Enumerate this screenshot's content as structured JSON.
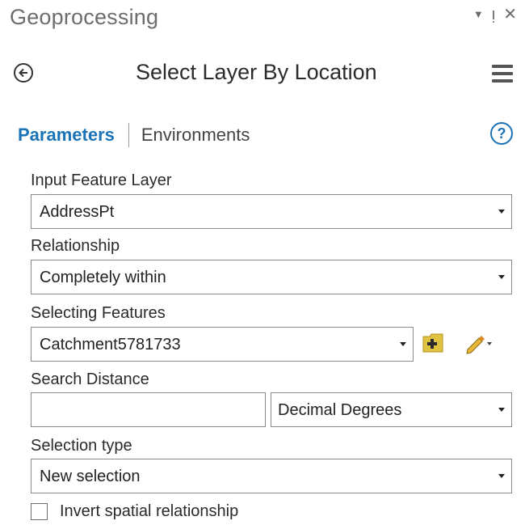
{
  "pane": {
    "title": "Geoprocessing",
    "controls": {
      "dropdown": "▼",
      "pin": "ᴉ",
      "close": "✕"
    }
  },
  "tool": {
    "title": "Select Layer By Location",
    "back_icon": "back-arrow-icon",
    "menu_icon": "hamburger-menu-icon"
  },
  "tabs": {
    "parameters": "Parameters",
    "environments": "Environments",
    "help_label": "?"
  },
  "params": {
    "input_layer": {
      "label": "Input Feature Layer",
      "value": "AddressPt"
    },
    "relationship": {
      "label": "Relationship",
      "value": "Completely within"
    },
    "selecting_features": {
      "label": "Selecting Features",
      "value": "Catchment5781733"
    },
    "search_distance": {
      "label": "Search Distance",
      "value": "",
      "unit": "Decimal Degrees"
    },
    "selection_type": {
      "label": "Selection type",
      "value": "New selection"
    },
    "invert": {
      "label": "Invert spatial relationship",
      "checked": false
    }
  },
  "colors": {
    "accent": "#1a73b6",
    "field_border": "#8a8a8a"
  }
}
